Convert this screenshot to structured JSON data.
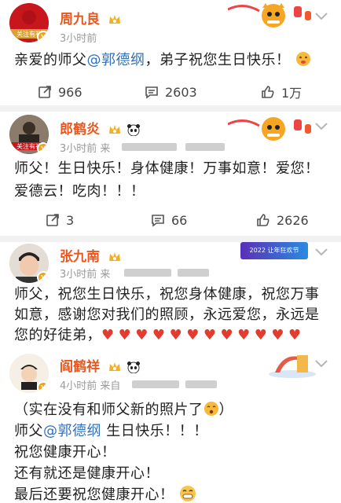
{
  "post1": {
    "user": "周九良",
    "meta": "3小时前",
    "avatar_tag": "关注有礼",
    "text": "亲爱的师父",
    "mention": "@郭德纲",
    "text_after": "，弟子祝您生日快乐！",
    "actions": {
      "repost": "966",
      "comment": "2603",
      "like": "1万"
    }
  },
  "post2": {
    "user": "郎鹤炎",
    "meta": "3小时前 来",
    "avatar_tag": "关注有礼",
    "text": "师父！生日快乐！身体健康！万事如意！爱您！爱德云！吃肉！！！",
    "actions": {
      "repost": "3",
      "comment": "66",
      "like": "2626"
    }
  },
  "post3": {
    "user": "张九南",
    "meta": "3小时前 来",
    "text": "师父，祝您生日快乐，祝您身体健康，祝您万事如意，感谢您对我们的照顾，永远爱您，永远是您的好徒弟，",
    "banner": "2022 让年狂欢节"
  },
  "post4": {
    "user": "阎鹤祥",
    "meta": "4小时前 来自",
    "lines": [
      "（实在没有和师父新的照片了",
      "祝您健康开心！",
      "还有就还是健康开心！",
      "最后还要祝您健康开心！"
    ],
    "line2_before": "师父",
    "line2_mention": "@郭德纲",
    "line2_after": "生日快乐！！！"
  },
  "colors": {
    "name": "#e8571f",
    "mention": "#3271b8",
    "meta": "#9a9a9a"
  }
}
